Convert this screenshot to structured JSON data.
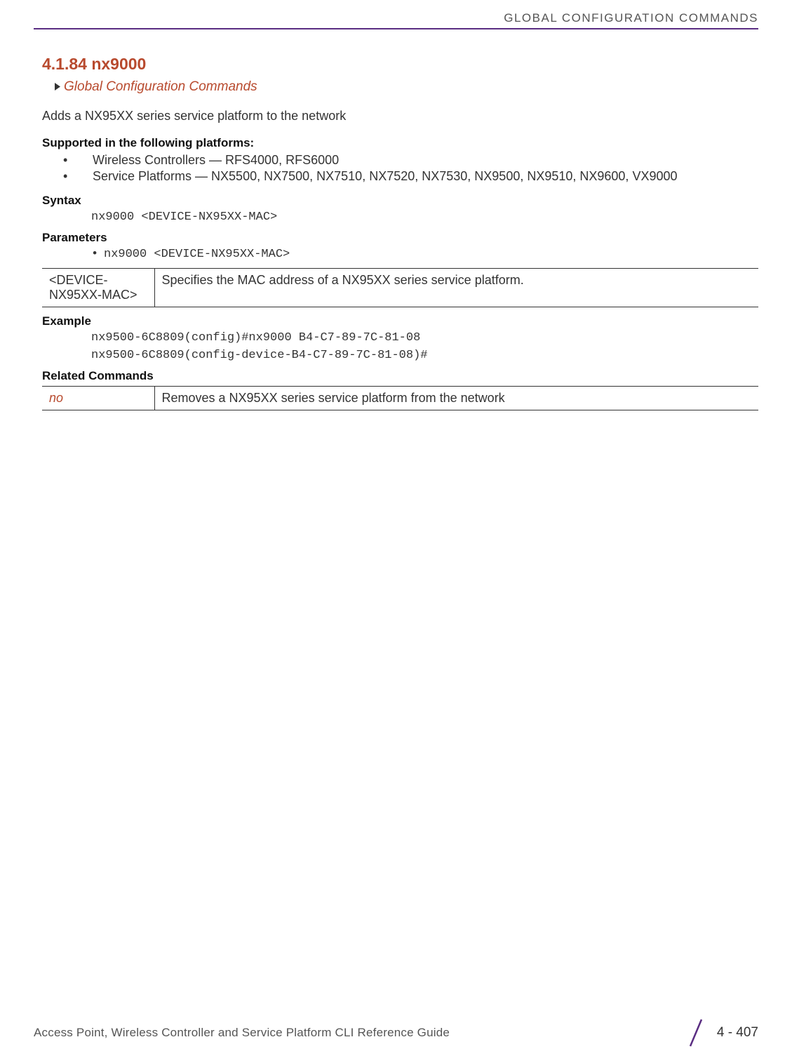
{
  "header": {
    "chapter_title": "GLOBAL CONFIGURATION COMMANDS"
  },
  "section": {
    "number_title": "4.1.84 nx9000",
    "breadcrumb": "Global Configuration Commands",
    "description": "Adds a NX95XX series service platform to the network"
  },
  "supported": {
    "heading": "Supported in the following platforms:",
    "items": [
      "Wireless Controllers — RFS4000, RFS6000",
      "Service Platforms — NX5500, NX7500, NX7510, NX7520, NX7530, NX9500, NX9510, NX9600, VX9000"
    ]
  },
  "syntax": {
    "heading": "Syntax",
    "code": "nx9000 <DEVICE-NX95XX-MAC>"
  },
  "parameters": {
    "heading": "Parameters",
    "bullet_code": "nx9000 <DEVICE-NX95XX-MAC>",
    "table": {
      "col1": "<DEVICE-NX95XX-MAC>",
      "col2": "Specifies the MAC address of a NX95XX series service platform."
    }
  },
  "example": {
    "heading": "Example",
    "line1": "nx9500-6C8809(config)#nx9000 B4-C7-89-7C-81-08",
    "line2": "nx9500-6C8809(config-device-B4-C7-89-7C-81-08)#"
  },
  "related": {
    "heading": "Related Commands",
    "table": {
      "col1": "no",
      "col2": "Removes a NX95XX series service platform from the network"
    }
  },
  "footer": {
    "title": "Access Point, Wireless Controller and Service Platform CLI Reference Guide",
    "page": "4 - 407"
  }
}
